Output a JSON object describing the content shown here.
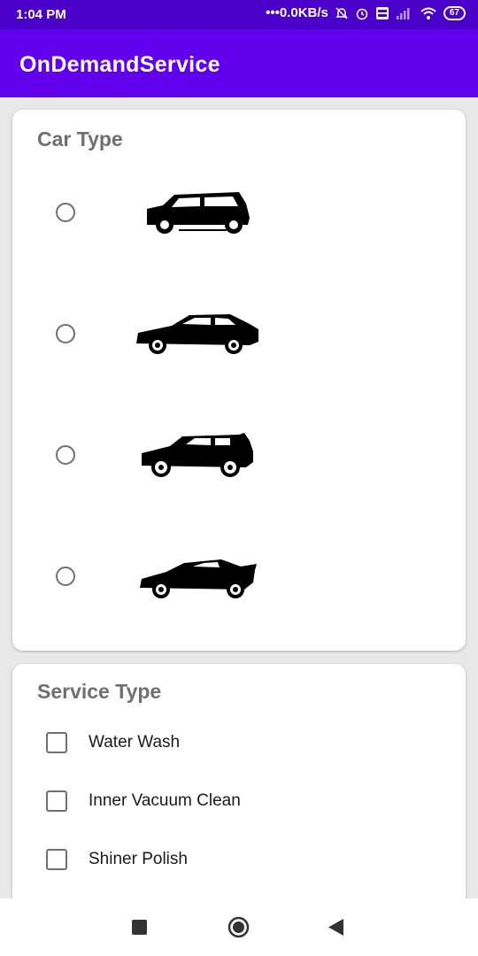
{
  "status_bar": {
    "time": "1:04 PM",
    "network_speed": "0.0KB/s",
    "battery": "67",
    "icons": [
      "dots-icon",
      "mute-icon",
      "alarm-icon",
      "volte-icon",
      "signal-icon",
      "wifi-icon",
      "battery-icon"
    ]
  },
  "app_bar": {
    "title": "OnDemandService"
  },
  "car_type": {
    "title": "Car Type",
    "options": [
      {
        "name": "hatchback",
        "icon": "hatchback-car-icon",
        "selected": false
      },
      {
        "name": "sedan",
        "icon": "sedan-car-icon",
        "selected": false
      },
      {
        "name": "suv",
        "icon": "suv-car-icon",
        "selected": false
      },
      {
        "name": "sports",
        "icon": "sports-car-icon",
        "selected": false
      }
    ]
  },
  "service_type": {
    "title": "Service Type",
    "options": [
      {
        "label": "Water Wash",
        "checked": false
      },
      {
        "label": "Inner Vacuum Clean",
        "checked": false
      },
      {
        "label": "Shiner Polish",
        "checked": false
      }
    ]
  },
  "nav_bar": {
    "buttons": [
      "recents-square-icon",
      "home-circle-icon",
      "back-triangle-icon"
    ]
  },
  "colors": {
    "status_bar": "#4a00c8",
    "app_bar": "#6200ee",
    "background": "#e8e8e8"
  }
}
